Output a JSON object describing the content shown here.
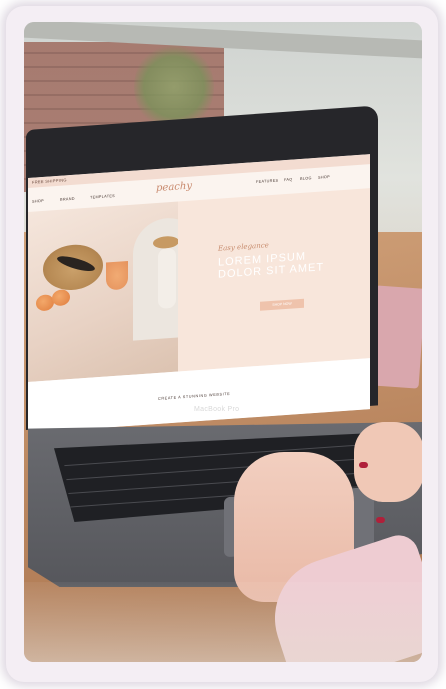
{
  "website": {
    "logo": "peachy",
    "topbar_text": "free shipping",
    "nav_left": [
      "shop",
      "brand",
      "templates"
    ],
    "nav_right": [
      "features",
      "faq",
      "blog",
      "shop"
    ],
    "hero_script": "Easy elegance",
    "hero_title_lines": [
      "Lorem ipsum",
      "dolor sit amet"
    ],
    "hero_button": "shop now",
    "footer_text": "create a stunning website"
  },
  "laptop": {
    "model_label": "MacBook Pro"
  },
  "colors": {
    "frame_border": "#f4eef4",
    "website_pink": "#f8e6db",
    "logo_peach": "#c98a6e",
    "nail_polish": "#b0203a",
    "sleeve_pink": "#eeccd2"
  }
}
